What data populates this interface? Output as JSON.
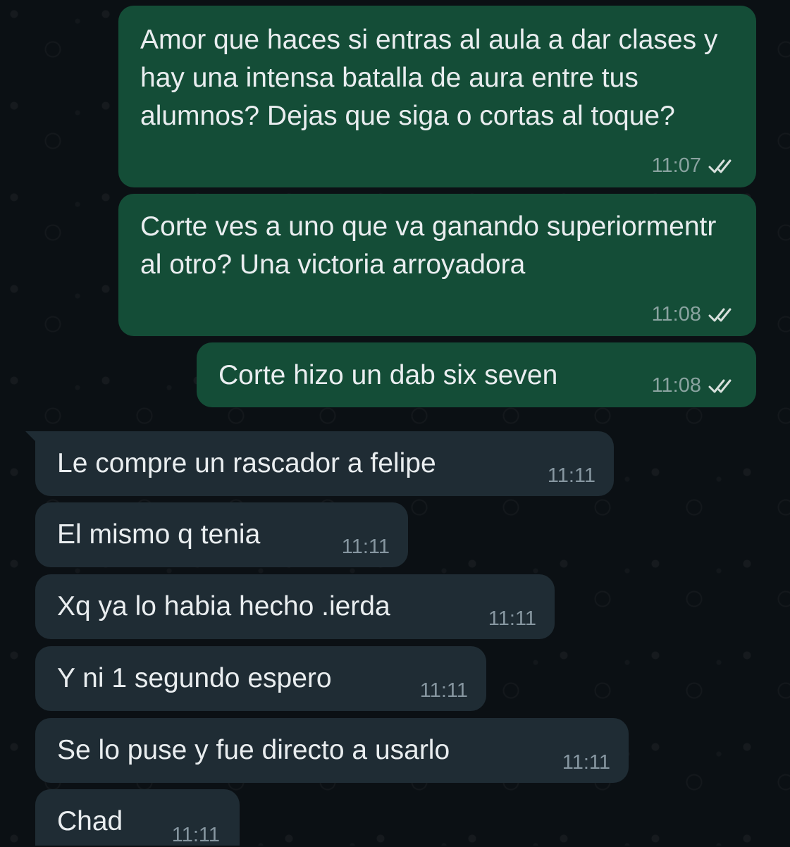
{
  "messages": [
    {
      "direction": "outgoing",
      "text": "Amor que haces si entras al aula a dar clases y hay una intensa batalla de aura entre tus alumnos? Dejas que siga o cortas al toque?",
      "time": "11:07",
      "status": "read",
      "icon": "double-check-icon"
    },
    {
      "direction": "outgoing",
      "text": "Corte ves a uno que va ganando superiormentr al otro? Una victoria arroyadora",
      "time": "11:08",
      "status": "read",
      "icon": "double-check-icon"
    },
    {
      "direction": "outgoing",
      "text": "Corte hizo un dab six seven",
      "time": "11:08",
      "status": "read",
      "icon": "double-check-icon"
    },
    {
      "direction": "incoming",
      "text": "Le compre un rascador a felipe",
      "time": "11:11"
    },
    {
      "direction": "incoming",
      "text": "El mismo q tenia",
      "time": "11:11"
    },
    {
      "direction": "incoming",
      "text": "Xq ya lo habia hecho .ierda",
      "time": "11:11"
    },
    {
      "direction": "incoming",
      "text": "Y ni 1 segundo espero",
      "time": "11:11"
    },
    {
      "direction": "incoming",
      "text": "Se lo puse y fue directo a usarlo",
      "time": "11:11"
    },
    {
      "direction": "incoming",
      "text": "Chad",
      "time": "11:11"
    }
  ],
  "colors": {
    "outgoing_bubble": "#144d37",
    "incoming_bubble": "#1f2c34",
    "background": "#0b1014",
    "text": "#e9edef",
    "read_ticks": "#d8e0dd"
  }
}
